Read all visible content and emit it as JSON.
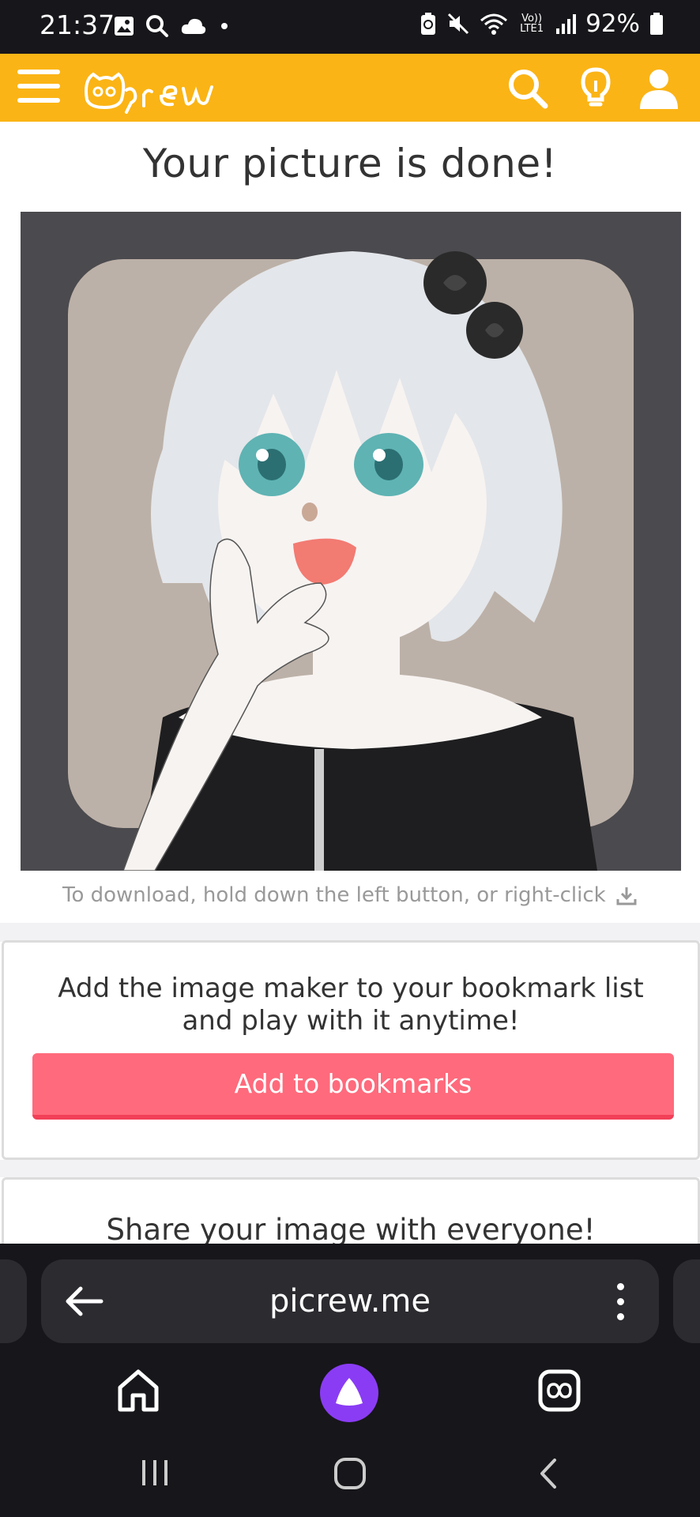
{
  "status_bar": {
    "time": "21:37",
    "battery": "92%",
    "icons": [
      "gallery-icon",
      "search-icon",
      "cloud-icon",
      "dot-icon",
      "battery-saver-icon",
      "mute-icon",
      "wifi-icon",
      "volte-icon",
      "signal-icon",
      "battery-icon"
    ],
    "volte_label": "Vo)) LTE1"
  },
  "header": {
    "logo": "Picrew",
    "brand_color": "#fbb415",
    "icons": [
      "menu-icon",
      "search-icon",
      "lightbulb-icon",
      "user-icon"
    ]
  },
  "main": {
    "title": "Your picture is done!",
    "download_hint": "To download, hold down the left button, or right-click"
  },
  "bookmark_card": {
    "text": "Add the image maker to your bookmark list and play with it anytime!",
    "button_label": "Add to bookmarks",
    "button_color": "#ff6a7c"
  },
  "share_card": {
    "text": "Share your image with everyone!"
  },
  "browser": {
    "url": "picrew.me",
    "bottom_nav": [
      "home-icon",
      "assistant-icon",
      "tabs-icon"
    ],
    "assistant_color": "#8a3cf4"
  },
  "system_nav": [
    "recents-icon",
    "home-icon",
    "back-icon"
  ]
}
